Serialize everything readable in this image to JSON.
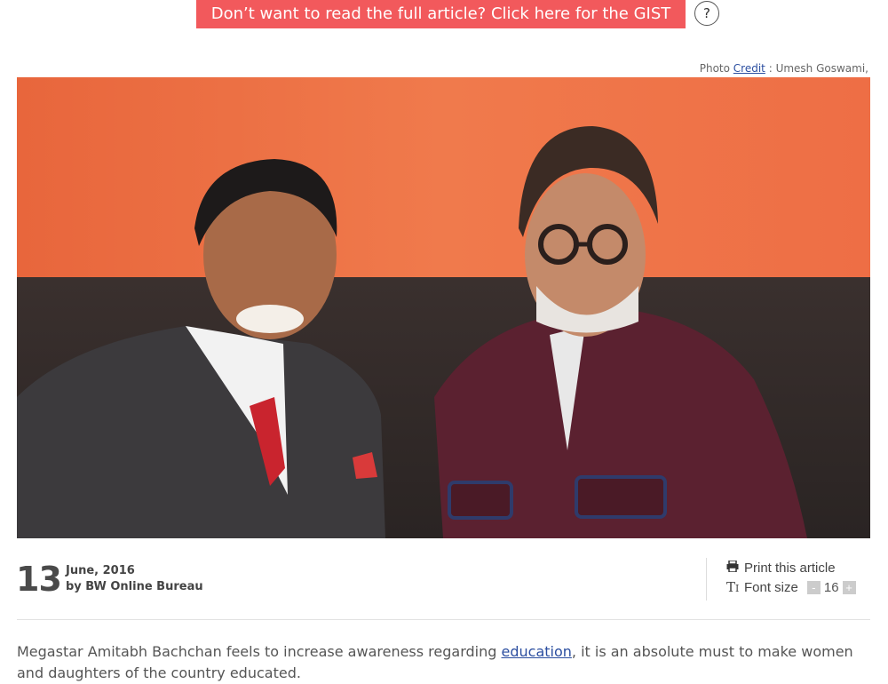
{
  "gist": {
    "banner_text": "Don’t want to read the full article? Click here for the GIST",
    "help_label": "?"
  },
  "photo": {
    "credit_prefix": "Photo ",
    "credit_link": "Credit",
    "credit_suffix": " : Umesh Goswami,"
  },
  "article": {
    "date_day": "13",
    "date_month_year": "June, 2016",
    "byline": "by BW Online Bureau",
    "lead_before": "Megastar Amitabh Bachchan feels to increase awareness regarding ",
    "lead_link": "education",
    "lead_after": ", it is an absolute must to make women and daughters of the country educated."
  },
  "tools": {
    "print_label": "Print this article",
    "print_icon": "printer-icon",
    "font_size_icon": "text-size-icon",
    "font_size_label": "Font size",
    "font_size_minus": "-",
    "font_size_value": "16",
    "font_size_plus": "+"
  },
  "colors": {
    "gist_banner": "#f2595c",
    "link": "#2b4ea0"
  }
}
